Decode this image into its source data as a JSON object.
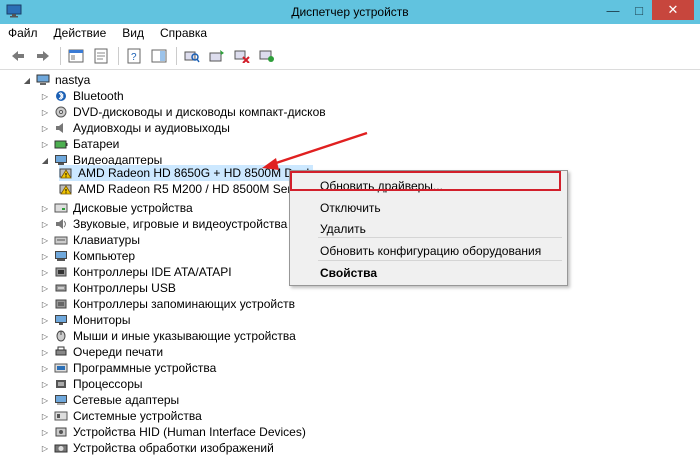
{
  "window": {
    "title": "Диспетчер устройств"
  },
  "menu": [
    "Файл",
    "Действие",
    "Вид",
    "Справка"
  ],
  "tree": {
    "root": "nastya",
    "categories": [
      "Bluetooth",
      "DVD-дисководы и дисководы компакт-дисков",
      "Аудиовходы и аудиовыходы",
      "Батареи",
      "Видеоадаптеры",
      "Дисковые устройства",
      "Звуковые, игровые и видеоустройства",
      "Клавиатуры",
      "Компьютер",
      "Контроллеры IDE ATA/ATAPI",
      "Контроллеры USB",
      "Контроллеры запоминающих устройств",
      "Мониторы",
      "Мыши и иные указывающие устройства",
      "Очереди печати",
      "Программные устройства",
      "Процессоры",
      "Сетевые адаптеры",
      "Системные устройства",
      "Устройства HID (Human Interface Devices)",
      "Устройства обработки изображений"
    ],
    "video_devices": [
      "AMD Radeon HD 8650G + HD 8500M Dual",
      "AMD Radeon R5 M200 / HD 8500M Series"
    ]
  },
  "context_menu": {
    "update_drivers": "Обновить драйверы...",
    "disable": "Отключить",
    "delete": "Удалить",
    "scan": "Обновить конфигурацию оборудования",
    "properties": "Свойства"
  },
  "colors": {
    "titlebar": "#61c3df",
    "highlight": "#d21f2b",
    "arrow": "#e02020"
  }
}
